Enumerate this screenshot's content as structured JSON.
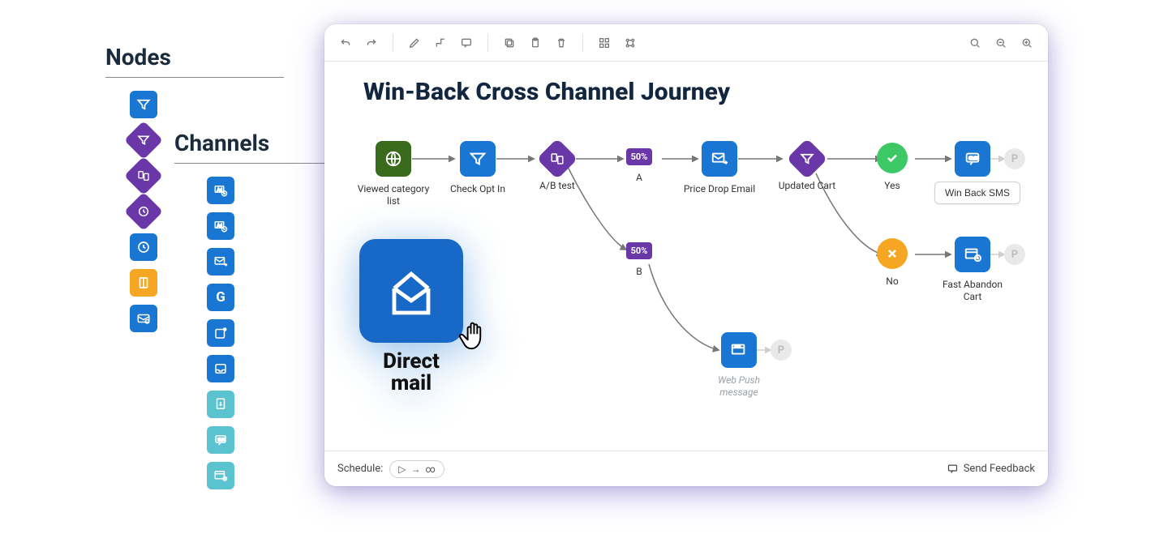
{
  "sections": {
    "nodes_title": "Nodes",
    "channels_title": "Channels"
  },
  "palettes": {
    "nodes": [
      {
        "name": "filter-node",
        "color": "blue",
        "icon": "funnel"
      },
      {
        "name": "filter-condition-node",
        "color": "purple",
        "icon": "funnel",
        "shape": "diamond"
      },
      {
        "name": "ab-test-node",
        "color": "purple",
        "icon": "ab",
        "shape": "diamond"
      },
      {
        "name": "delay-node",
        "color": "purple",
        "icon": "clock",
        "shape": "diamond"
      },
      {
        "name": "wait-node",
        "color": "blue",
        "icon": "clock"
      },
      {
        "name": "page-node",
        "color": "orange",
        "icon": "page"
      },
      {
        "name": "inbox-node",
        "color": "blue",
        "icon": "envelope-link"
      }
    ],
    "channels": [
      {
        "name": "ad-add-channel",
        "color": "blue",
        "icon": "ad-plus"
      },
      {
        "name": "ad-remove-channel",
        "color": "blue",
        "icon": "ad-minus"
      },
      {
        "name": "email-send-channel",
        "color": "blue",
        "icon": "mail-arrow"
      },
      {
        "name": "google-channel",
        "color": "blue",
        "icon": "google"
      },
      {
        "name": "push-channel",
        "color": "blue",
        "icon": "push-dot"
      },
      {
        "name": "inbox-channel",
        "color": "blue",
        "icon": "inbox"
      },
      {
        "name": "direct-mail-channel",
        "color": "teal",
        "icon": "file-down"
      },
      {
        "name": "sms-channel",
        "color": "teal",
        "icon": "sms"
      },
      {
        "name": "web-push-channel",
        "color": "teal",
        "icon": "web-push"
      }
    ]
  },
  "canvas": {
    "title": "Win-Back Cross Channel Journey",
    "toolbar": {
      "groups": [
        [
          "undo",
          "redo"
        ],
        [
          "edit",
          "connector",
          "comment"
        ],
        [
          "copy",
          "paste",
          "delete"
        ],
        [
          "select-all",
          "select-group"
        ]
      ],
      "right": [
        "zoom-fit",
        "zoom-out",
        "zoom-in"
      ]
    },
    "footer": {
      "schedule_label": "Schedule:",
      "schedule_value": "▷ → ∞",
      "feedback_label": "Send Feedback"
    },
    "nodes": {
      "viewed_category": {
        "label": "Viewed category list"
      },
      "check_opt_in": {
        "label": "Check Opt In"
      },
      "ab_test": {
        "label": "A/B test"
      },
      "branch_a": {
        "label": "A",
        "percent": "50%"
      },
      "branch_b": {
        "label": "B",
        "percent": "50%"
      },
      "price_drop_email": {
        "label": "Price Drop Email"
      },
      "updated_cart": {
        "label": "Updated Cart"
      },
      "yes": {
        "label": "Yes"
      },
      "no": {
        "label": "No"
      },
      "win_back_sms": {
        "label": "Win Back SMS"
      },
      "fast_abandon_cart": {
        "label": "Fast Abandon Cart"
      },
      "web_push_message": {
        "label": "Web Push message"
      }
    }
  },
  "dragged": {
    "label_line1": "Direct",
    "label_line2": "mail"
  }
}
